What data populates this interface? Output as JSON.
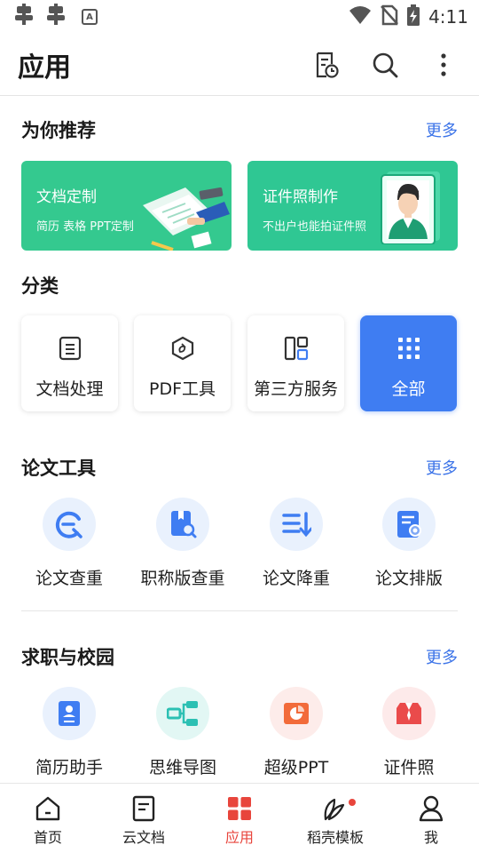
{
  "statusbar": {
    "time": "4:11",
    "left_icons": [
      "bug-icon",
      "bug-icon",
      "font-a-icon"
    ],
    "right_icons": [
      "wifi-icon",
      "no-sim-icon",
      "battery-charging-icon"
    ]
  },
  "appbar": {
    "title": "应用",
    "actions": [
      "history-doc-icon",
      "search-icon",
      "more-vert-icon"
    ]
  },
  "recommend": {
    "title": "为你推荐",
    "more": "更多",
    "banners": [
      {
        "title": "文档定制",
        "subtitle": "简历 表格 PPT定制",
        "color": "#34c98f"
      },
      {
        "title": "证件照制作",
        "subtitle": "不出户也能拍证件照",
        "color": "#2fc793"
      }
    ]
  },
  "category": {
    "title": "分类",
    "items": [
      {
        "label": "文档处理",
        "icon": "document-icon"
      },
      {
        "label": "PDF工具",
        "icon": "pdf-tool-icon"
      },
      {
        "label": "第三方服务",
        "icon": "layout-grid-icon"
      },
      {
        "label": "全部",
        "icon": "apps-grid-icon",
        "active": true
      }
    ]
  },
  "paper_tools": {
    "title": "论文工具",
    "more": "更多",
    "items": [
      {
        "label": "论文查重",
        "icon": "plagiarism-check-icon"
      },
      {
        "label": "职称版查重",
        "icon": "book-search-icon"
      },
      {
        "label": "论文降重",
        "icon": "reduce-list-icon"
      },
      {
        "label": "论文排版",
        "icon": "doc-award-icon"
      }
    ]
  },
  "career": {
    "title": "求职与校园",
    "more": "更多",
    "items": [
      {
        "label": "简历助手",
        "icon": "resume-icon"
      },
      {
        "label": "思维导图",
        "icon": "mindmap-icon"
      },
      {
        "label": "超级PPT",
        "icon": "ppt-icon"
      },
      {
        "label": "证件照",
        "icon": "id-photo-icon"
      }
    ]
  },
  "tabbar": {
    "items": [
      {
        "label": "首页",
        "icon": "home-icon"
      },
      {
        "label": "云文档",
        "icon": "cloud-doc-icon"
      },
      {
        "label": "应用",
        "icon": "apps-icon",
        "active": true
      },
      {
        "label": "稻壳模板",
        "icon": "leaf-icon",
        "badge": true
      },
      {
        "label": "我",
        "icon": "person-icon"
      }
    ]
  },
  "colors": {
    "accent_blue": "#3f7df2",
    "link_blue": "#3b73e8",
    "active_red": "#e8453c",
    "banner_green": "#34c98f"
  }
}
